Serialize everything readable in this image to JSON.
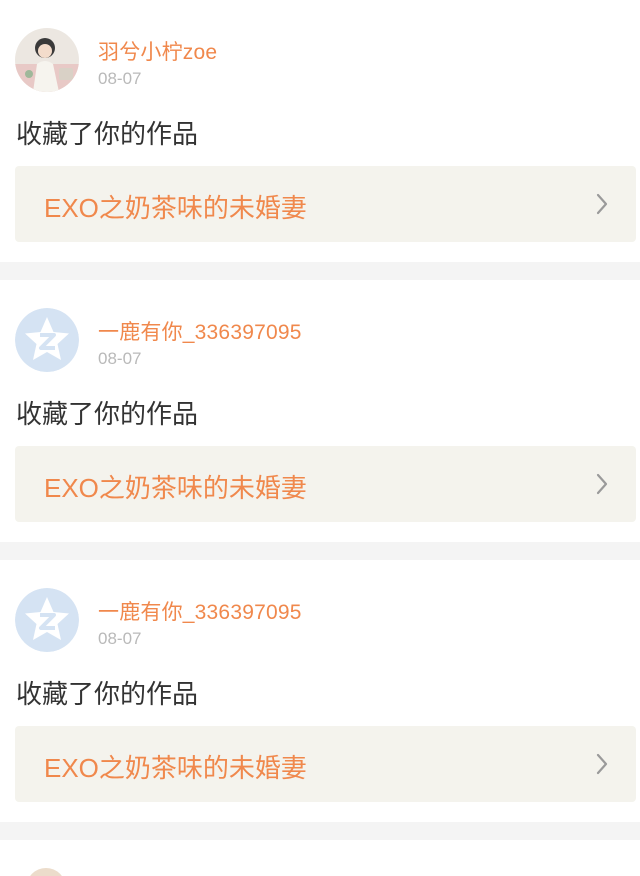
{
  "notifications": [
    {
      "username": "羽兮小柠zoe",
      "date": "08-07",
      "action": "收藏了你的作品",
      "work_title": "EXO之奶茶味的未婚妻",
      "avatar": "photo-avatar-icon"
    },
    {
      "username": "一鹿有你_336397095",
      "date": "08-07",
      "action": "收藏了你的作品",
      "work_title": "EXO之奶茶味的未婚妻",
      "avatar": "default-qzone-avatar-icon"
    },
    {
      "username": "一鹿有你_336397095",
      "date": "08-07",
      "action": "收藏了你的作品",
      "work_title": "EXO之奶茶味的未婚妻",
      "avatar": "default-qzone-avatar-icon"
    }
  ],
  "colors": {
    "accent": "#f0884c",
    "work_bg": "#f4f3ed",
    "divider": "#f4f4f4",
    "date": "#b9b9b9",
    "text": "#333333"
  }
}
